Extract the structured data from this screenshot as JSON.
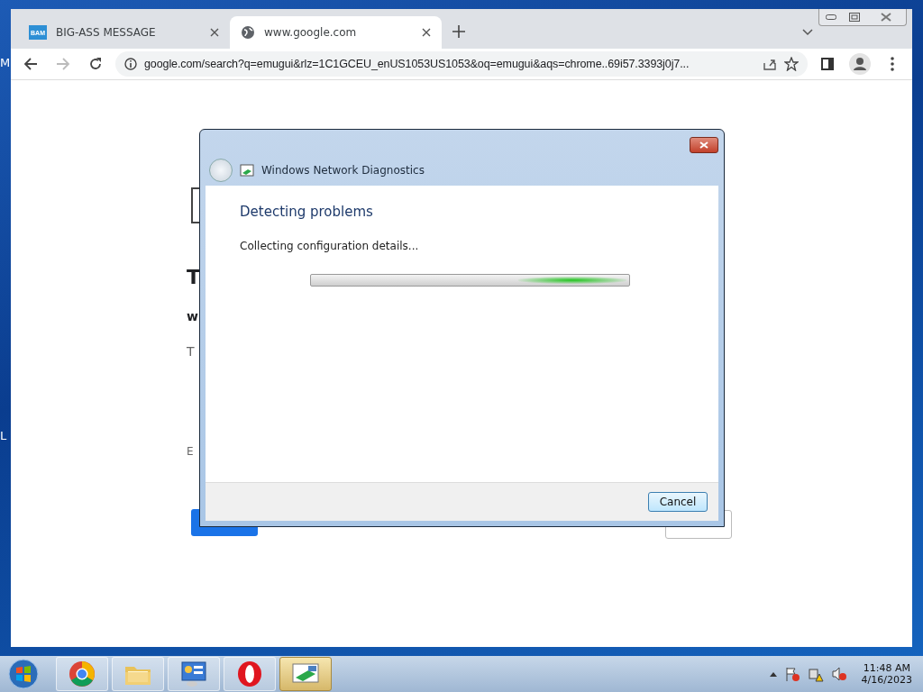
{
  "desktop": {
    "labels": [
      "M",
      "L"
    ]
  },
  "browser": {
    "tabs": [
      {
        "label": "BIG-ASS MESSAGE",
        "favicon_text": "BAM",
        "selected": false
      },
      {
        "label": "www.google.com",
        "selected": true
      }
    ],
    "address": "google.com/search?q=emugui&rlz=1C1GCEU_enUS1053US1053&oq=emugui&aqs=chrome..69i57.3393j0j7...",
    "page": {
      "heading": "T",
      "subheading": "w",
      "line": "T",
      "note": "E"
    }
  },
  "dialog": {
    "title": "Windows Network Diagnostics",
    "heading": "Detecting problems",
    "status": "Collecting configuration details...",
    "progress": {
      "kind": "marquee"
    },
    "buttons": [
      "Cancel"
    ]
  },
  "taskbar": {
    "apps": [
      {
        "kind": "chrome",
        "selected": false
      },
      {
        "kind": "folder",
        "selected": false
      },
      {
        "kind": "control-panel",
        "selected": false
      },
      {
        "kind": "opera",
        "selected": false
      },
      {
        "kind": "network",
        "selected": true
      }
    ],
    "time": "11:48 AM",
    "date": "4/16/2023"
  }
}
